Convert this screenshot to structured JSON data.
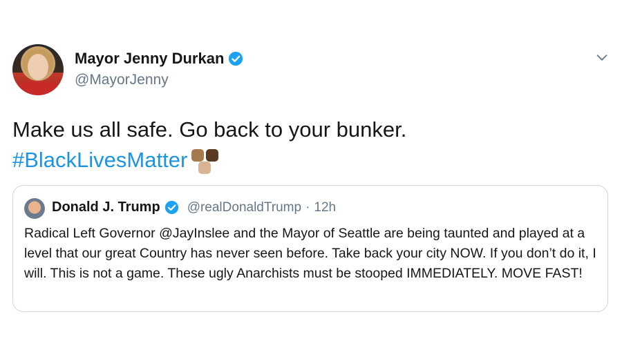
{
  "tweet": {
    "author_name": "Mayor Jenny Durkan",
    "author_handle": "@MayorJenny",
    "text_line1": "Make us all safe. Go back to your bunker.",
    "hashtag": "#BlackLivesMatter",
    "emoji": "fist-emojis",
    "verified_color": "#1da1f2",
    "hashtag_color": "#1b95e0"
  },
  "quoted_tweet": {
    "author_name": "Donald J. Trump",
    "author_handle": "@realDonaldTrump",
    "separator": "·",
    "time": "12h",
    "text": "Radical Left Governor @JayInslee and the Mayor of Seattle are being taunted and played at a level that our great Country has never seen before. Take back your city NOW. If you don’t do it, I will. This is not a game. These ugly Anarchists must be stooped IMMEDIATELY. MOVE FAST!"
  }
}
